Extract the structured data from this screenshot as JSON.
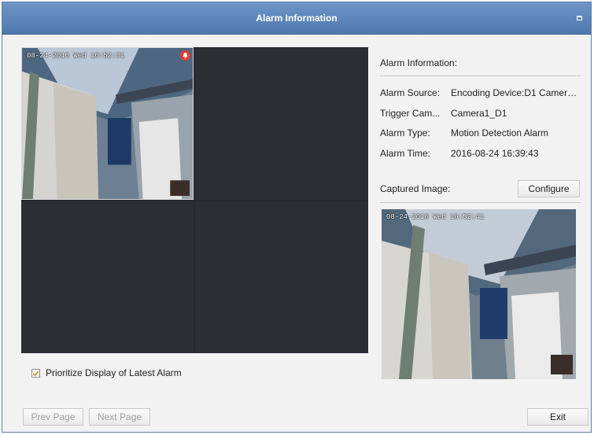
{
  "window": {
    "title": "Alarm Information",
    "restore_icon": "restore-icon"
  },
  "grid": {
    "cells": [
      {
        "osd": "08-24-2016 Wed 16:52:31",
        "badge_icon": "alarm-bell-icon"
      },
      {},
      {},
      {}
    ]
  },
  "options": {
    "prioritize_label": "Prioritize Display of Latest Alarm",
    "prioritize_checked": true
  },
  "pager": {
    "prev_label": "Prev Page",
    "next_label": "Next Page"
  },
  "info": {
    "heading": "Alarm Information:",
    "rows": [
      {
        "key": "Alarm Source:",
        "value": "Encoding Device:D1 Camera1..."
      },
      {
        "key": "Trigger Cam...",
        "value": "Camera1_D1"
      },
      {
        "key": "Alarm Type:",
        "value": "Motion Detection Alarm"
      },
      {
        "key": "Alarm Time:",
        "value": "2016-08-24 16:39:43"
      }
    ]
  },
  "captured": {
    "heading": "Captured Image:",
    "configure_label": "Configure",
    "osd": "08-24-2016 Wed 16:52:41"
  },
  "footer": {
    "exit_label": "Exit"
  },
  "colors": {
    "titlebar": "#5b83b7",
    "alarm_badge": "#e23b2e",
    "check": "#d98a1e"
  }
}
